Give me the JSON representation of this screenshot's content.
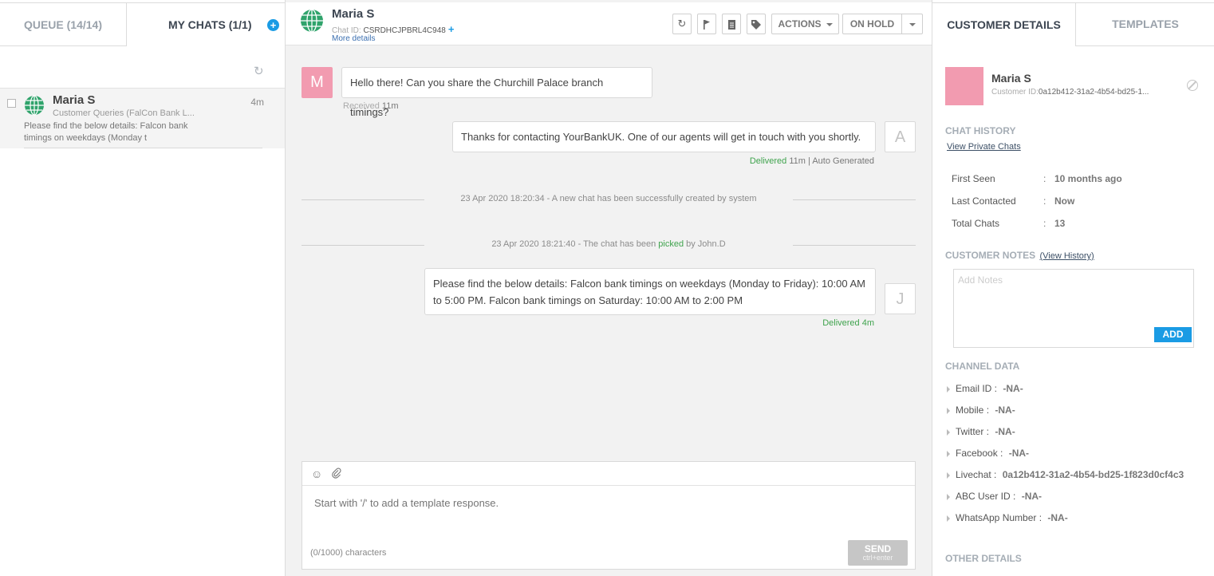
{
  "left": {
    "tabs": {
      "queue": "QUEUE (14/14)",
      "my_chats": "MY CHATS (1/1)"
    },
    "new_chat_icon": "+",
    "refresh_icon": "refresh-icon",
    "chat_item": {
      "name": "Maria S",
      "time": "4m",
      "subtitle": "Customer Queries (FalCon Bank L...",
      "preview_line1": "Please find the below details: Falcon bank",
      "preview_line2": "timings on weekdays (Monday t"
    }
  },
  "header": {
    "name": "Maria S",
    "chat_id_label": "Chat ID: ",
    "chat_id": "CSRDHCJPBRL4C948",
    "chat_id_plus": "+",
    "more_details": "More details",
    "actions_label": "ACTIONS",
    "on_hold_label": "ON HOLD",
    "icons": [
      "refresh-icon",
      "flag-icon",
      "document-icon",
      "tag-icon"
    ]
  },
  "messages": {
    "m1": {
      "avatar": "M",
      "text": "Hello there! Can you share the Churchill Palace branch timings?",
      "status": "Received",
      "time": "11m"
    },
    "m2": {
      "avatar": "A",
      "text": "Thanks for contacting YourBankUK. One of our agents will get in touch with you shortly.",
      "status": "Delivered",
      "time": "11m",
      "note": "| Auto Generated"
    },
    "sys1": "23 Apr 2020 18:20:34 - A new chat has been successfully created by system",
    "sys2": {
      "before": "23 Apr 2020 18:21:40 - The chat has been ",
      "action": "picked",
      "after": " by John.D"
    },
    "m3": {
      "avatar": "J",
      "text": "Please find the below details: Falcon bank timings on weekdays (Monday to Friday): 10:00 AM to 5:00 PM. Falcon bank timings on Saturday: 10:00 AM to 2:00 PM",
      "status": "Delivered",
      "time": "4m"
    }
  },
  "composer": {
    "placeholder": "Start with '/' to add a template response.",
    "char_count": "(0/1000) characters",
    "send_label": "SEND",
    "send_shortcut": "ctrl+enter"
  },
  "right": {
    "tabs": {
      "customer_details": "CUSTOMER DETAILS",
      "templates": "TEMPLATES"
    },
    "customer": {
      "name": "Maria S",
      "id_label": "Customer ID:",
      "id": "0a12b412-31a2-4b54-bd25-1..."
    },
    "chat_history_title": "CHAT HISTORY",
    "view_private_chats": "View Private Chats",
    "stats": [
      {
        "label": "First Seen",
        "value": "10 months ago"
      },
      {
        "label": "Last Contacted",
        "value": "Now"
      },
      {
        "label": "Total Chats",
        "value": "13"
      }
    ],
    "notes_title": "CUSTOMER NOTES",
    "view_history": "(View History)",
    "notes_placeholder": "Add Notes",
    "add_label": "ADD",
    "channel_title": "CHANNEL DATA",
    "channels": [
      {
        "label": "Email ID",
        "value": "-NA-"
      },
      {
        "label": "Mobile",
        "value": "-NA-"
      },
      {
        "label": "Twitter",
        "value": "-NA-"
      },
      {
        "label": "Facebook",
        "value": "-NA-"
      },
      {
        "label": "Livechat",
        "value": "0a12b412-31a2-4b54-bd25-1f823d0cf4c3"
      },
      {
        "label": "ABC User ID",
        "value": "-NA-"
      },
      {
        "label": "WhatsApp Number",
        "value": "-NA-"
      }
    ],
    "other_title": "OTHER DETAILS"
  },
  "colors": {
    "accent": "#1a9be4",
    "avatar_pink": "#f29bb0",
    "delivered_green": "#3fa34d"
  }
}
